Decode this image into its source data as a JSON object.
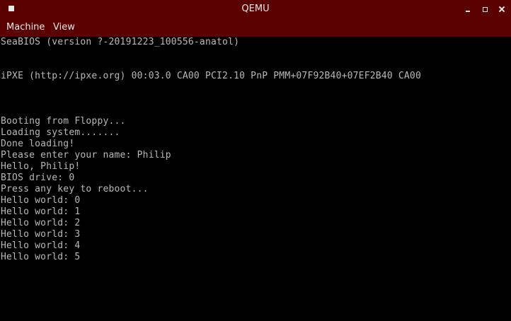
{
  "window": {
    "title": "QEMU"
  },
  "menu": {
    "items": [
      "Machine",
      "View"
    ]
  },
  "console": {
    "lines": [
      "SeaBIOS (version ?-20191223_100556-anatol)",
      "",
      "",
      "iPXE (http://ipxe.org) 00:03.0 CA00 PCI2.10 PnP PMM+07F92B40+07EF2B40 CA00",
      "",
      "",
      "",
      "Booting from Floppy...",
      "Loading system.......",
      "Done loading!",
      "Please enter your name: Philip",
      "Hello, Philip!",
      "BIOS drive: 0",
      "Press any key to reboot...",
      "Hello world: 0",
      "Hello world: 1",
      "Hello world: 2",
      "Hello world: 3",
      "Hello world: 4",
      "Hello world: 5"
    ]
  },
  "colors": {
    "titlebar": "#5a0000",
    "console_text": "#b8b8b8",
    "console_bg": "#000000"
  }
}
